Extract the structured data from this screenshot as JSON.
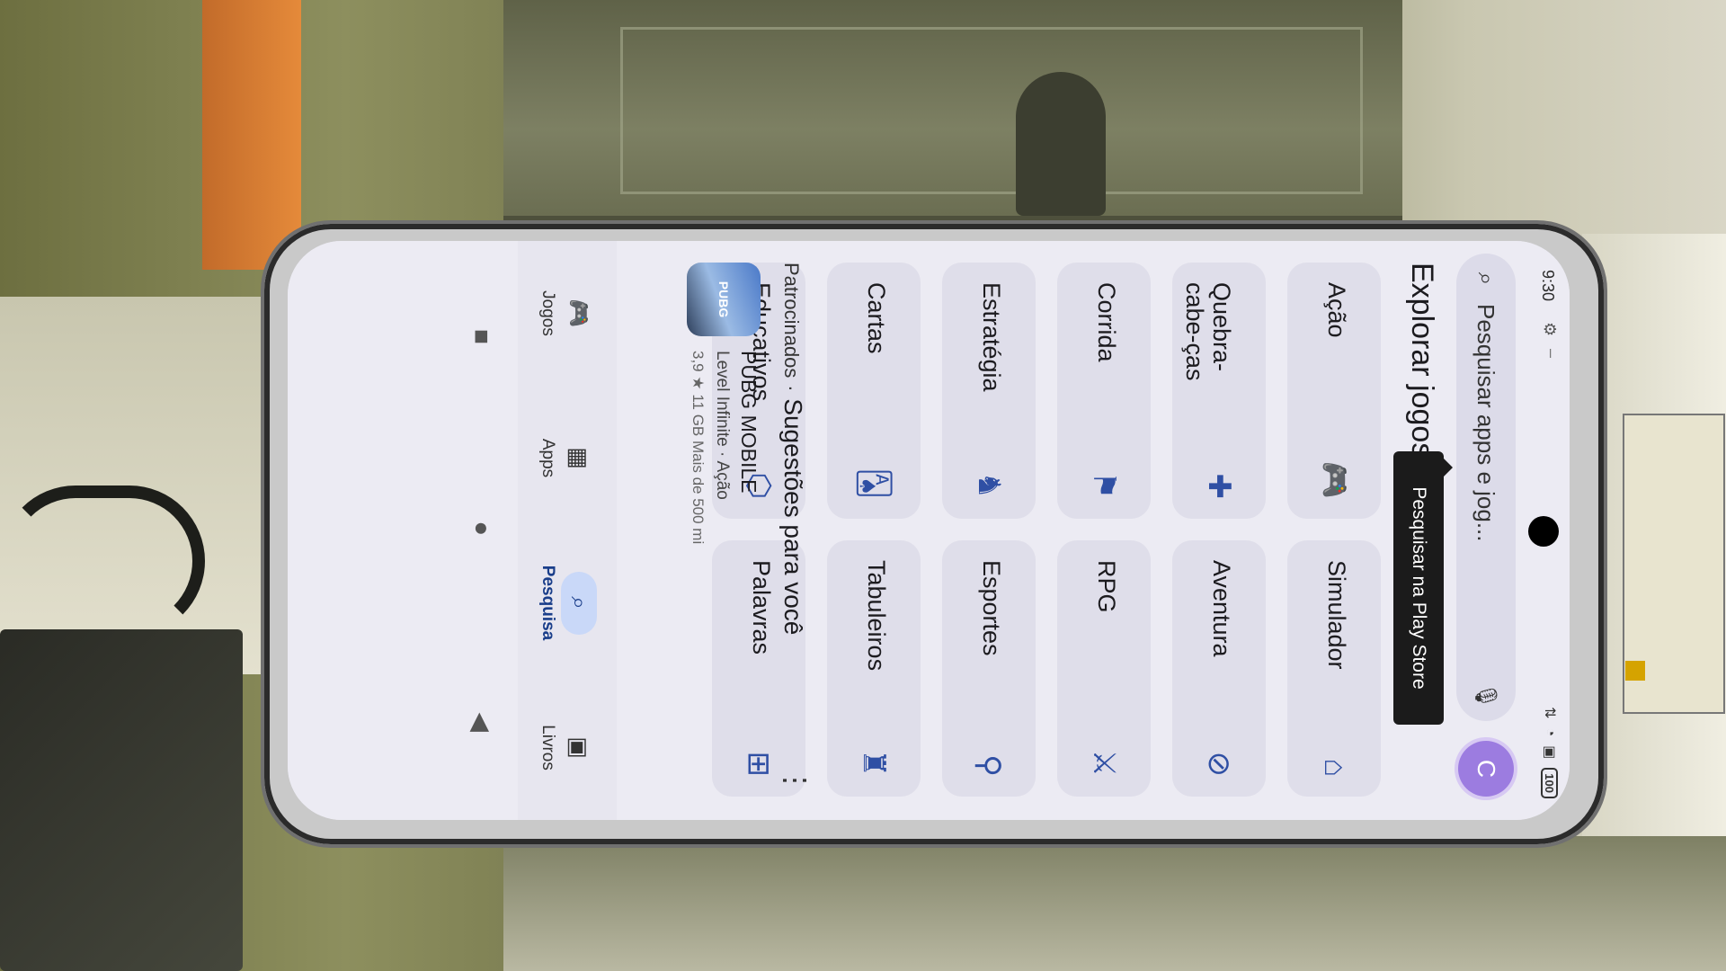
{
  "status_bar": {
    "time": "9:30",
    "battery": "100"
  },
  "search": {
    "placeholder": "Pesquisar apps e jog..."
  },
  "account": {
    "avatar_initial": "C"
  },
  "tooltip": {
    "text": "Pesquisar na Play Store"
  },
  "explore": {
    "title": "Explorar jogos",
    "categories": [
      {
        "label": "Ação",
        "icon": "gamepad-icon"
      },
      {
        "label": "Simulador",
        "icon": "vr-headset-icon"
      },
      {
        "label": "Quebra-cabe-ças",
        "icon": "puzzle-icon"
      },
      {
        "label": "Aventura",
        "icon": "compass-icon"
      },
      {
        "label": "Corrida",
        "icon": "flag-icon"
      },
      {
        "label": "RPG",
        "icon": "swords-icon"
      },
      {
        "label": "Estratégia",
        "icon": "chess-icon"
      },
      {
        "label": "Esportes",
        "icon": "racket-icon"
      },
      {
        "label": "Cartas",
        "icon": "cards-icon"
      },
      {
        "label": "Tabuleiros",
        "icon": "board-icon"
      },
      {
        "label": "Educativos",
        "icon": "education-icon"
      },
      {
        "label": "Palavras",
        "icon": "word-tiles-icon"
      }
    ]
  },
  "sponsored": {
    "prefix": "Patrocinados",
    "separator": "·",
    "title": "Sugestões para você",
    "app": {
      "name": "PUBG MOBILE",
      "developer": "Level Infinite",
      "category": "Ação",
      "meta2": "3,9 ★   11 GB   Mais de 500 mi"
    }
  },
  "bottom_nav": {
    "items": [
      {
        "label": "Jogos",
        "active": false
      },
      {
        "label": "Apps",
        "active": false
      },
      {
        "label": "Pesquisa",
        "active": true
      },
      {
        "label": "Livros",
        "active": false
      }
    ]
  },
  "colors": {
    "accent": "#2f4fa4",
    "tile_bg": "#dfdeea",
    "avatar": "#9c7ce0"
  }
}
